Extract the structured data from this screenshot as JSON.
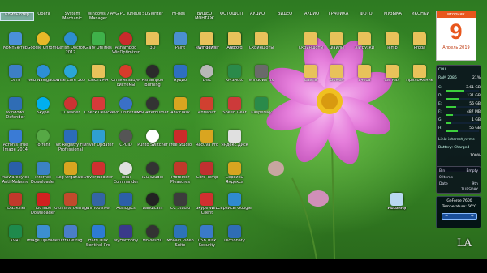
{
  "top_row": [
    "Компьютер",
    "Opera",
    "System Mechanic",
    "Windows 7 Manager",
    "AVG PC TuneUp",
    "SDSWriter",
    "Hi-Res",
    "ВИДЕО МОНТАЖ",
    "ФОТОШОП",
    "АУДИО",
    "ВИДЕО",
    "АУДИО",
    "ГРАФИКА",
    "ФОТО",
    "МУЗЫКА",
    "ИКОНКИ"
  ],
  "columns": [
    [
      {
        "label": "Компьютер",
        "icon": "computer-icon",
        "color": "#4a90d9",
        "shape": "sq"
      },
      {
        "label": "Сеть",
        "icon": "network-icon",
        "color": "#3d7fc7",
        "shape": "sq"
      },
      {
        "label": "Windows Defender",
        "icon": "defender-icon",
        "color": "#2f6db5",
        "shape": "sq"
      },
      {
        "label": "Acronis True Image 2014",
        "icon": "acronis-icon",
        "color": "#3a7bd5",
        "shape": "sq"
      },
      {
        "label": "Malwarebytes Anti-Malware",
        "icon": "malwarebytes-icon",
        "color": "#2a5fa8",
        "shape": "sq"
      },
      {
        "label": "TDSSKiller",
        "icon": "tdsskiller-icon",
        "color": "#c0392b",
        "shape": "sq"
      },
      {
        "label": "KVRT",
        "icon": "kvrt-icon",
        "color": "#1e8a4c",
        "shape": "sq"
      }
    ],
    [
      {
        "label": "Google Chrome",
        "icon": "chrome-icon",
        "color": "#e7b928",
        "shape": "round"
      },
      {
        "label": "Web Navigation",
        "icon": "web-icon",
        "color": "#2d8fd5",
        "shape": "round"
      },
      {
        "label": "Skype",
        "icon": "skype-icon",
        "color": "#00aff0",
        "shape": "round"
      },
      {
        "label": "Torrent",
        "icon": "torrent-icon",
        "color": "#56a845",
        "shape": "round"
      },
      {
        "label": "Internet Downloader",
        "icon": "download-icon",
        "color": "#3b82c4",
        "shape": "sq"
      },
      {
        "label": "YouTube Downloader",
        "icon": "youtube-icon",
        "color": "#d12020",
        "shape": "sq"
      },
      {
        "label": "Image Uploader",
        "icon": "upload-icon",
        "color": "#3c8fd0",
        "shape": "sq"
      }
    ],
    [
      {
        "label": "Kerish Doctor 2017",
        "icon": "kerish-icon",
        "color": "#2d8ecf",
        "shape": "round"
      },
      {
        "label": "Wise Care 365",
        "icon": "wisecare-icon",
        "color": "#2aa6d8",
        "shape": "round"
      },
      {
        "label": "CCleaner",
        "icon": "ccleaner-icon",
        "color": "#cc3333",
        "shape": "round"
      },
      {
        "label": "Vit Registry Fix Professional",
        "icon": "registry-icon",
        "color": "#2b6cb8",
        "shape": "sq"
      },
      {
        "label": "Reg Organizer",
        "icon": "regorganizer-icon",
        "color": "#d9a520",
        "shape": "sq"
      },
      {
        "label": "Ultimate Defrag",
        "icon": "defrag-icon",
        "color": "#c24a2c",
        "shape": "sq"
      },
      {
        "label": "UltraDefrag",
        "icon": "ultradefrag-icon",
        "color": "#4a7ec9",
        "shape": "sq"
      }
    ],
    [
      {
        "label": "Glary Utilities",
        "icon": "glary-icon",
        "color": "#3fb14a",
        "shape": "sq"
      },
      {
        "label": "СИСТЕМА",
        "icon": "folder-icon",
        "color": "#e8c25a",
        "shape": "folder"
      },
      {
        "label": "Check Device",
        "icon": "device-icon",
        "color": "#d63a3a",
        "shape": "sq"
      },
      {
        "label": "Driver Updater",
        "icon": "driver-icon",
        "color": "#2f9fd0",
        "shape": "sq"
      },
      {
        "label": "Driver Booster",
        "icon": "driverbooster-icon",
        "color": "#cf3030",
        "shape": "sq"
      },
      {
        "label": "WinToolsNet",
        "icon": "wintools-icon",
        "color": "#3465a4",
        "shape": "sq"
      },
      {
        "label": "Hard Disk Sentinel Pro",
        "icon": "hdsentinel-icon",
        "color": "#2d7bd4",
        "shape": "sq"
      }
    ],
    [
      {
        "label": "Ashampoo WinOptimizer",
        "icon": "ashampoo-icon",
        "color": "#c92b2b",
        "shape": "round"
      },
      {
        "label": "Оптимизация системы",
        "icon": "optimize-icon",
        "color": "#d63b2b",
        "shape": "round"
      },
      {
        "label": "Revo Uninstaller",
        "icon": "revo-icon",
        "color": "#3a70c8",
        "shape": "round"
      },
      {
        "label": "CPUID",
        "icon": "cpuid-icon",
        "color": "#555555",
        "shape": "round"
      },
      {
        "label": "Total Commander",
        "icon": "totalcmd-icon",
        "color": "#e0e0e0",
        "shape": "round"
      },
      {
        "label": "Auslogics",
        "icon": "auslogics-icon",
        "color": "#2c5fa8",
        "shape": "sq"
      },
      {
        "label": "MyHarmony",
        "icon": "harmony-icon",
        "color": "#3a3a8a",
        "shape": "sq"
      }
    ],
    [
      {
        "label": "3D",
        "icon": "folder-icon",
        "color": "#e8c25a",
        "shape": "folder"
      },
      {
        "label": "Ashampoo Burning",
        "icon": "burning-icon",
        "color": "#2b2b2b",
        "shape": "round"
      },
      {
        "label": "MSI Afterburner",
        "icon": "afterburner-icon",
        "color": "#333333",
        "shape": "round"
      },
      {
        "label": "Punto Switcher",
        "icon": "punto-icon",
        "color": "#ffffff",
        "shape": "round"
      },
      {
        "label": "ISO Studio",
        "icon": "iso-icon",
        "color": "#333333",
        "shape": "round"
      },
      {
        "label": "Bandicam",
        "icon": "bandicam-icon",
        "color": "#222222",
        "shape": "round"
      },
      {
        "label": "MoviesHD",
        "icon": "movies-icon",
        "color": "#333333",
        "shape": "round"
      }
    ],
    [
      {
        "label": "Paint",
        "icon": "paint-icon",
        "color": "#4a8fd0",
        "shape": "sq"
      },
      {
        "label": "Аудио",
        "icon": "audio-icon",
        "color": "#2e6fc0",
        "shape": "sq"
      },
      {
        "label": "AnvirTask",
        "icon": "anvir-icon",
        "color": "#d9a520",
        "shape": "sq"
      },
      {
        "label": "Free Studio",
        "icon": "freestudio-icon",
        "color": "#cc2a2a",
        "shape": "sq"
      },
      {
        "label": "Protector Pleasures",
        "icon": "protector-icon",
        "color": "#c0392b",
        "shape": "sq"
      },
      {
        "label": "СС Studio",
        "icon": "ccstudio-icon",
        "color": "#3c3c3c",
        "shape": "sq"
      },
      {
        "label": "Movavi Video Suite",
        "icon": "movavi-icon",
        "color": "#2d73b8",
        "shape": "sq"
      }
    ],
    [
      {
        "label": "TeamViewer",
        "icon": "teamviewer-icon",
        "color": "#1f6fd1",
        "shape": "sq"
      },
      {
        "label": "Disc",
        "icon": "disc-icon",
        "color": "#b8b8b8",
        "shape": "round"
      },
      {
        "label": "Аппарат",
        "icon": "apparat-icon",
        "color": "#d04030",
        "shape": "sq"
      },
      {
        "label": "Recuva Pro",
        "icon": "recuva-icon",
        "color": "#d9a520",
        "shape": "sq"
      },
      {
        "label": "Core Temp",
        "icon": "coretemp-icon",
        "color": "#c03030",
        "shape": "sq"
      },
      {
        "label": "Skype Web Client",
        "icon": "skypeweb-icon",
        "color": "#d03030",
        "shape": "sq"
      },
      {
        "label": "USB Disk Security",
        "icon": "usbdisk-icon",
        "color": "#3a7ac8",
        "shape": "sq"
      }
    ],
    [
      {
        "label": "Proxy",
        "icon": "proxy-icon",
        "color": "#3d8ed8",
        "shape": "sq"
      },
      {
        "label": "KMSAuto",
        "icon": "kmsauto-icon",
        "color": "#2a8a4a",
        "shape": "sq"
      },
      {
        "label": "Speed Gear",
        "icon": "speedgear-icon",
        "color": "#cc3a3a",
        "shape": "sq"
      },
      {
        "label": "Яндекс.Диск",
        "icon": "yadisk-icon",
        "color": "#e0e0e0",
        "shape": "sq"
      },
      {
        "label": "Сервисы Яндекса",
        "icon": "yandex-icon",
        "color": "#d9a520",
        "shape": "sq"
      },
      {
        "label": "Сервисы Google",
        "icon": "google-icon",
        "color": "#2f8ad0",
        "shape": "sq"
      },
      {
        "label": "Dictionary",
        "icon": "dictionary-icon",
        "color": "#2f6db5",
        "shape": "sq"
      }
    ],
    [
      {
        "label": "Windows Fix",
        "icon": "wfix-icon",
        "color": "#6a6a6a",
        "shape": "sq"
      },
      {
        "label": "Kaspersky",
        "icon": "kaspersky-icon",
        "color": "#2a8a4a",
        "shape": "sq"
      }
    ],
    [
      {
        "label": "Recovery",
        "icon": "recovery-icon",
        "color": "#e8b030",
        "shape": "round"
      }
    ]
  ],
  "scattered_icons": [
    {
      "label": "Скриншоты",
      "icon": "folder-icon",
      "color": "#e8c25a",
      "shape": "folder"
    },
    {
      "label": "Файлы",
      "icon": "folder-icon",
      "color": "#e8c25a",
      "shape": "folder"
    },
    {
      "label": "Загрузки",
      "icon": "folder-icon",
      "color": "#e8c25a",
      "shape": "folder"
    },
    {
      "label": "Temp",
      "icon": "folder-icon",
      "color": "#e8c25a",
      "shape": "folder"
    },
    {
      "label": "Proga",
      "icon": "folder-icon",
      "color": "#e8c25a",
      "shape": "folder"
    },
    {
      "label": "Сайты",
      "icon": "folder-icon",
      "color": "#e8c25a",
      "shape": "folder"
    },
    {
      "label": "Обмен",
      "icon": "folder-icon",
      "color": "#e8c25a",
      "shape": "folder"
    },
    {
      "label": "Учеба",
      "icon": "folder-icon",
      "color": "#e8c25a",
      "shape": "folder"
    },
    {
      "label": "Сигнал",
      "icon": "folder-icon",
      "color": "#e8c25a",
      "shape": "folder"
    },
    {
      "label": "Приложение",
      "icon": "folder-icon",
      "color": "#e8c25a",
      "shape": "folder"
    },
    {
      "label": "Windows",
      "icon": "folder-icon",
      "color": "#e8c25a",
      "shape": "folder"
    },
    {
      "label": "Android",
      "icon": "folder-icon",
      "color": "#e8c25a",
      "shape": "folder"
    },
    {
      "label": "Скриншоты",
      "icon": "folder-icon",
      "color": "#e8c25a",
      "shape": "folder"
    },
    {
      "label": "Корзина",
      "icon": "recycle-bin-icon",
      "color": "#b8d8f0",
      "shape": "sq"
    }
  ],
  "calendar": {
    "weekday": "вторник",
    "day": "9",
    "month": "Апрель 2019"
  },
  "sysmeter": {
    "cpu": "CPU",
    "ram": "RAM 2086",
    "ram_pct": "21%",
    "rows": [
      {
        "k": "C:",
        "v": "3.61 GB",
        "pct": 0.55
      },
      {
        "k": "D:",
        "v": "131 GB",
        "pct": 0.4
      },
      {
        "k": "E:",
        "v": "56 GB",
        "pct": 0.3
      },
      {
        "k": "F:",
        "v": "487 MB",
        "pct": 0.2
      },
      {
        "k": "G:",
        "v": "1 GB",
        "pct": 0.15
      },
      {
        "k": "H:",
        "v": "55 GB",
        "pct": 0.35
      }
    ],
    "wifi": "Link: internet_nvme",
    "battery": "Battery: Charged",
    "battery_pct": "100%"
  },
  "clock": {
    "bin_label": "Bin",
    "bin_value": "Empty",
    "items": "0 Items",
    "date_label": "Date",
    "date_value": "9th",
    "day": "TUESDAY"
  },
  "gpu": {
    "title": "GeForce 7600",
    "temp_label": "Temperature:",
    "temp_value": "66°C"
  },
  "logo": "LA",
  "colors": {
    "accent": "#e8561c",
    "flower": "#e07ad6",
    "flower_center": "#f0c020"
  }
}
